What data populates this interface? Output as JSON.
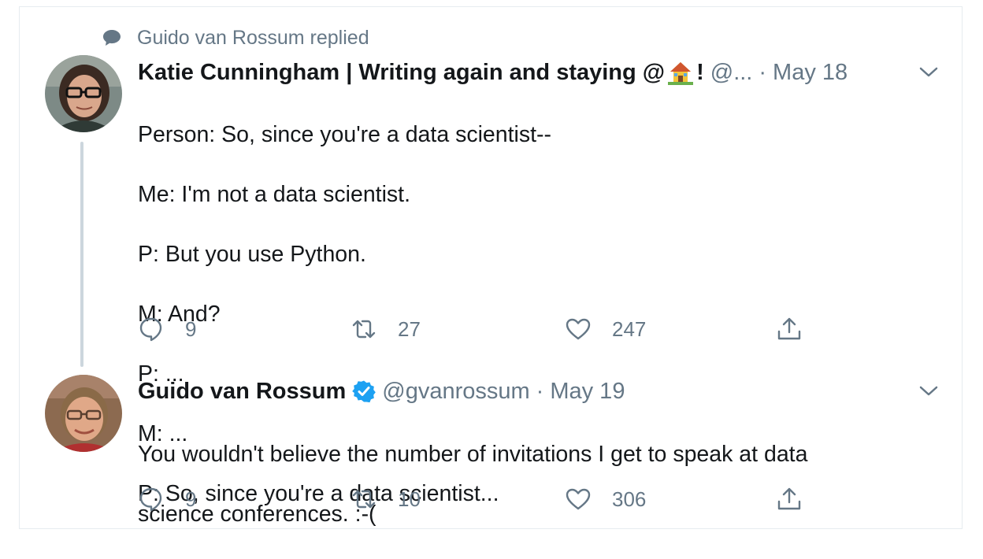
{
  "social_context": {
    "text": "Guido van Rossum replied",
    "icon": "speech-bubble-icon"
  },
  "tweets": [
    {
      "display_name": "Katie Cunningham | Writing again and staying @",
      "name_suffix": "!",
      "handle": "@...",
      "separator": "·",
      "date": "May 18",
      "lines": [
        "Person: So, since you're a data scientist--",
        "Me: I'm not a data scientist.",
        "P: But you use Python.",
        "M: And?",
        "P: ...",
        "M: ...",
        "P: So, since you're a data scientist..."
      ],
      "reply_count": "9",
      "retweet_count": "27",
      "like_count": "247"
    },
    {
      "display_name": "Guido van Rossum",
      "handle": "@gvanrossum",
      "separator": "·",
      "date": "May 19",
      "lines": [
        "You wouldn't believe the number of invitations I get to speak at data",
        "science conferences. :-("
      ],
      "reply_count": "9",
      "retweet_count": "10",
      "like_count": "306"
    }
  ],
  "colors": {
    "text": "#14171a",
    "secondary": "#657786",
    "verified": "#1da1f2",
    "thread_line": "#ccd6dd"
  }
}
